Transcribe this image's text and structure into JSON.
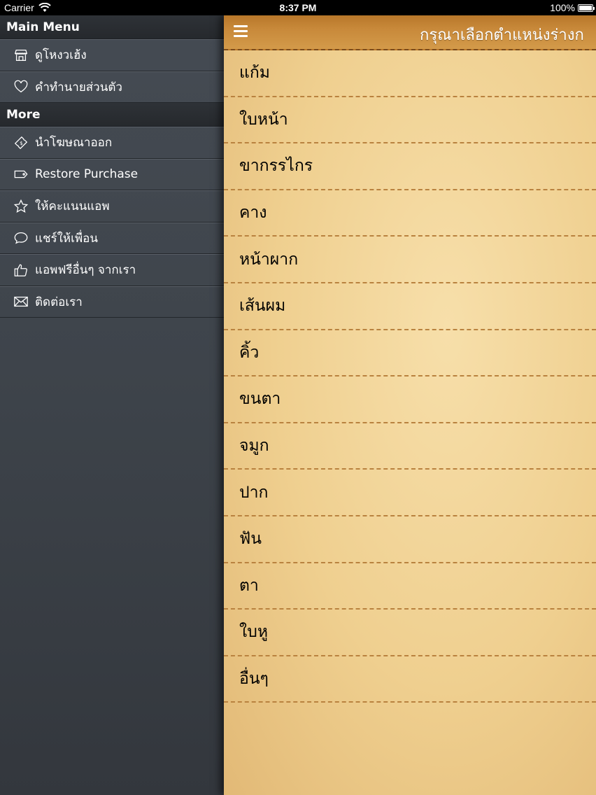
{
  "status_bar": {
    "carrier": "Carrier",
    "time": "8:37 PM",
    "battery": "100%"
  },
  "sidebar": {
    "sections": [
      {
        "header": "Main Menu",
        "items": [
          {
            "label": "ดูโหงวเฮ้ง",
            "icon": "store-icon"
          },
          {
            "label": "คำทำนายส่วนตัว",
            "icon": "heart-icon"
          }
        ]
      },
      {
        "header": "More",
        "items": [
          {
            "label": "นำโฆษณาออก",
            "icon": "ticket-icon"
          },
          {
            "label": "Restore Purchase",
            "icon": "tag-icon"
          },
          {
            "label": "ให้คะแนนแอพ",
            "icon": "star-icon"
          },
          {
            "label": "แชร์ให้เพื่อน",
            "icon": "chat-bubble-icon"
          },
          {
            "label": "แอพฟรีอื่นๆ จากเรา",
            "icon": "thumbs-up-icon"
          },
          {
            "label": "ติดต่อเรา",
            "icon": "envelope-icon"
          }
        ]
      }
    ]
  },
  "main": {
    "title": "กรุณาเลือกตำแหน่งร่างก",
    "menu_icon": "hamburger-icon",
    "items": [
      "แก้ม",
      "ใบหน้า",
      "ขากรรไกร",
      "คาง",
      "หน้าผาก",
      "เส้นผม",
      "คิ้ว",
      "ขนตา",
      "จมูก",
      "ปาก",
      "ฟัน",
      "ตา",
      "ใบหู",
      "อื่นๆ"
    ]
  }
}
